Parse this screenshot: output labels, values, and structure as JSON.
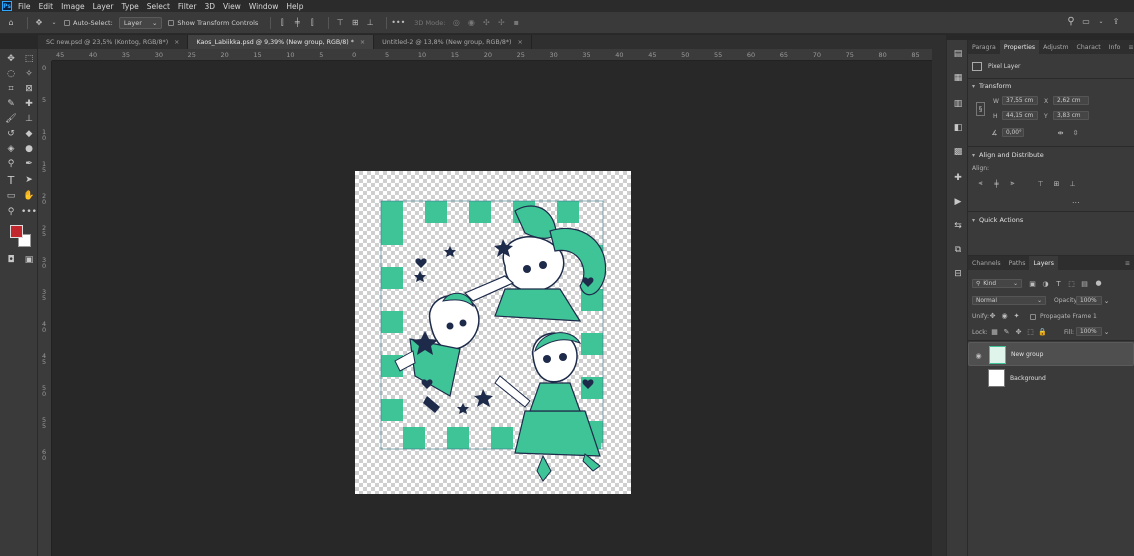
{
  "app": {
    "logo": "Ps"
  },
  "menu": [
    "File",
    "Edit",
    "Image",
    "Layer",
    "Type",
    "Select",
    "Filter",
    "3D",
    "View",
    "Window",
    "Help"
  ],
  "options": {
    "auto_select_label": "Auto-Select:",
    "auto_select_value": "Layer",
    "show_transform_label": "Show Transform Controls",
    "mode_3d": "3D Mode:"
  },
  "tabs": [
    {
      "label": "SC new.psd @ 23,5% (Kontog, RGB/8*)",
      "active": false
    },
    {
      "label": "Kaos_Labiikka.psd @ 9,39% (New group, RGB/8) *",
      "active": true
    },
    {
      "label": "Untitled-2 @ 13,8% (New group, RGB/8*)",
      "active": false
    }
  ],
  "ruler_h": [
    "45",
    "40",
    "35",
    "30",
    "25",
    "20",
    "15",
    "10",
    "5",
    "0",
    "5",
    "10",
    "15",
    "20",
    "25",
    "30",
    "35",
    "40",
    "45",
    "50",
    "55",
    "60",
    "65",
    "70",
    "75",
    "80",
    "85"
  ],
  "ruler_v": [
    "0",
    "5",
    "1\n0",
    "1\n5",
    "2\n0",
    "2\n5",
    "3\n0",
    "3\n5",
    "4\n0",
    "4\n5",
    "5\n0",
    "5\n5",
    "6\n0"
  ],
  "properties": {
    "tabs": [
      "Paragra",
      "Properties",
      "Adjustm",
      "Charact",
      "Info"
    ],
    "active_tab": 1,
    "layer_type": "Pixel Layer",
    "transform_title": "Transform",
    "w_label": "W",
    "w_value": "37,55 cm",
    "x_label": "X",
    "x_value": "2,62 cm",
    "h_label": "H",
    "h_value": "44,15 cm",
    "y_label": "Y",
    "y_value": "3,83 cm",
    "angle_value": "0,00°",
    "align_title": "Align and Distribute",
    "align_label": "Align:",
    "more": "...",
    "quick_actions_title": "Quick Actions"
  },
  "layers_panel": {
    "tabs": [
      "Channels",
      "Paths",
      "Layers"
    ],
    "active_tab": 2,
    "filter_kind": "Kind",
    "blend_mode": "Normal",
    "opacity_label": "Opacity:",
    "opacity_value": "100%",
    "unify_label": "Unify:",
    "propagate_label": "Propagate Frame 1",
    "lock_label": "Lock:",
    "fill_label": "Fill:",
    "fill_value": "100%",
    "layers": [
      {
        "name": "New group",
        "visible": true,
        "selected": true
      },
      {
        "name": "Background",
        "visible": false,
        "selected": false
      }
    ]
  },
  "colors": {
    "foreground": "#c1272d",
    "background": "#ffffff",
    "artwork_teal": "#3fc497",
    "artwork_navy": "#1d2a4a"
  }
}
